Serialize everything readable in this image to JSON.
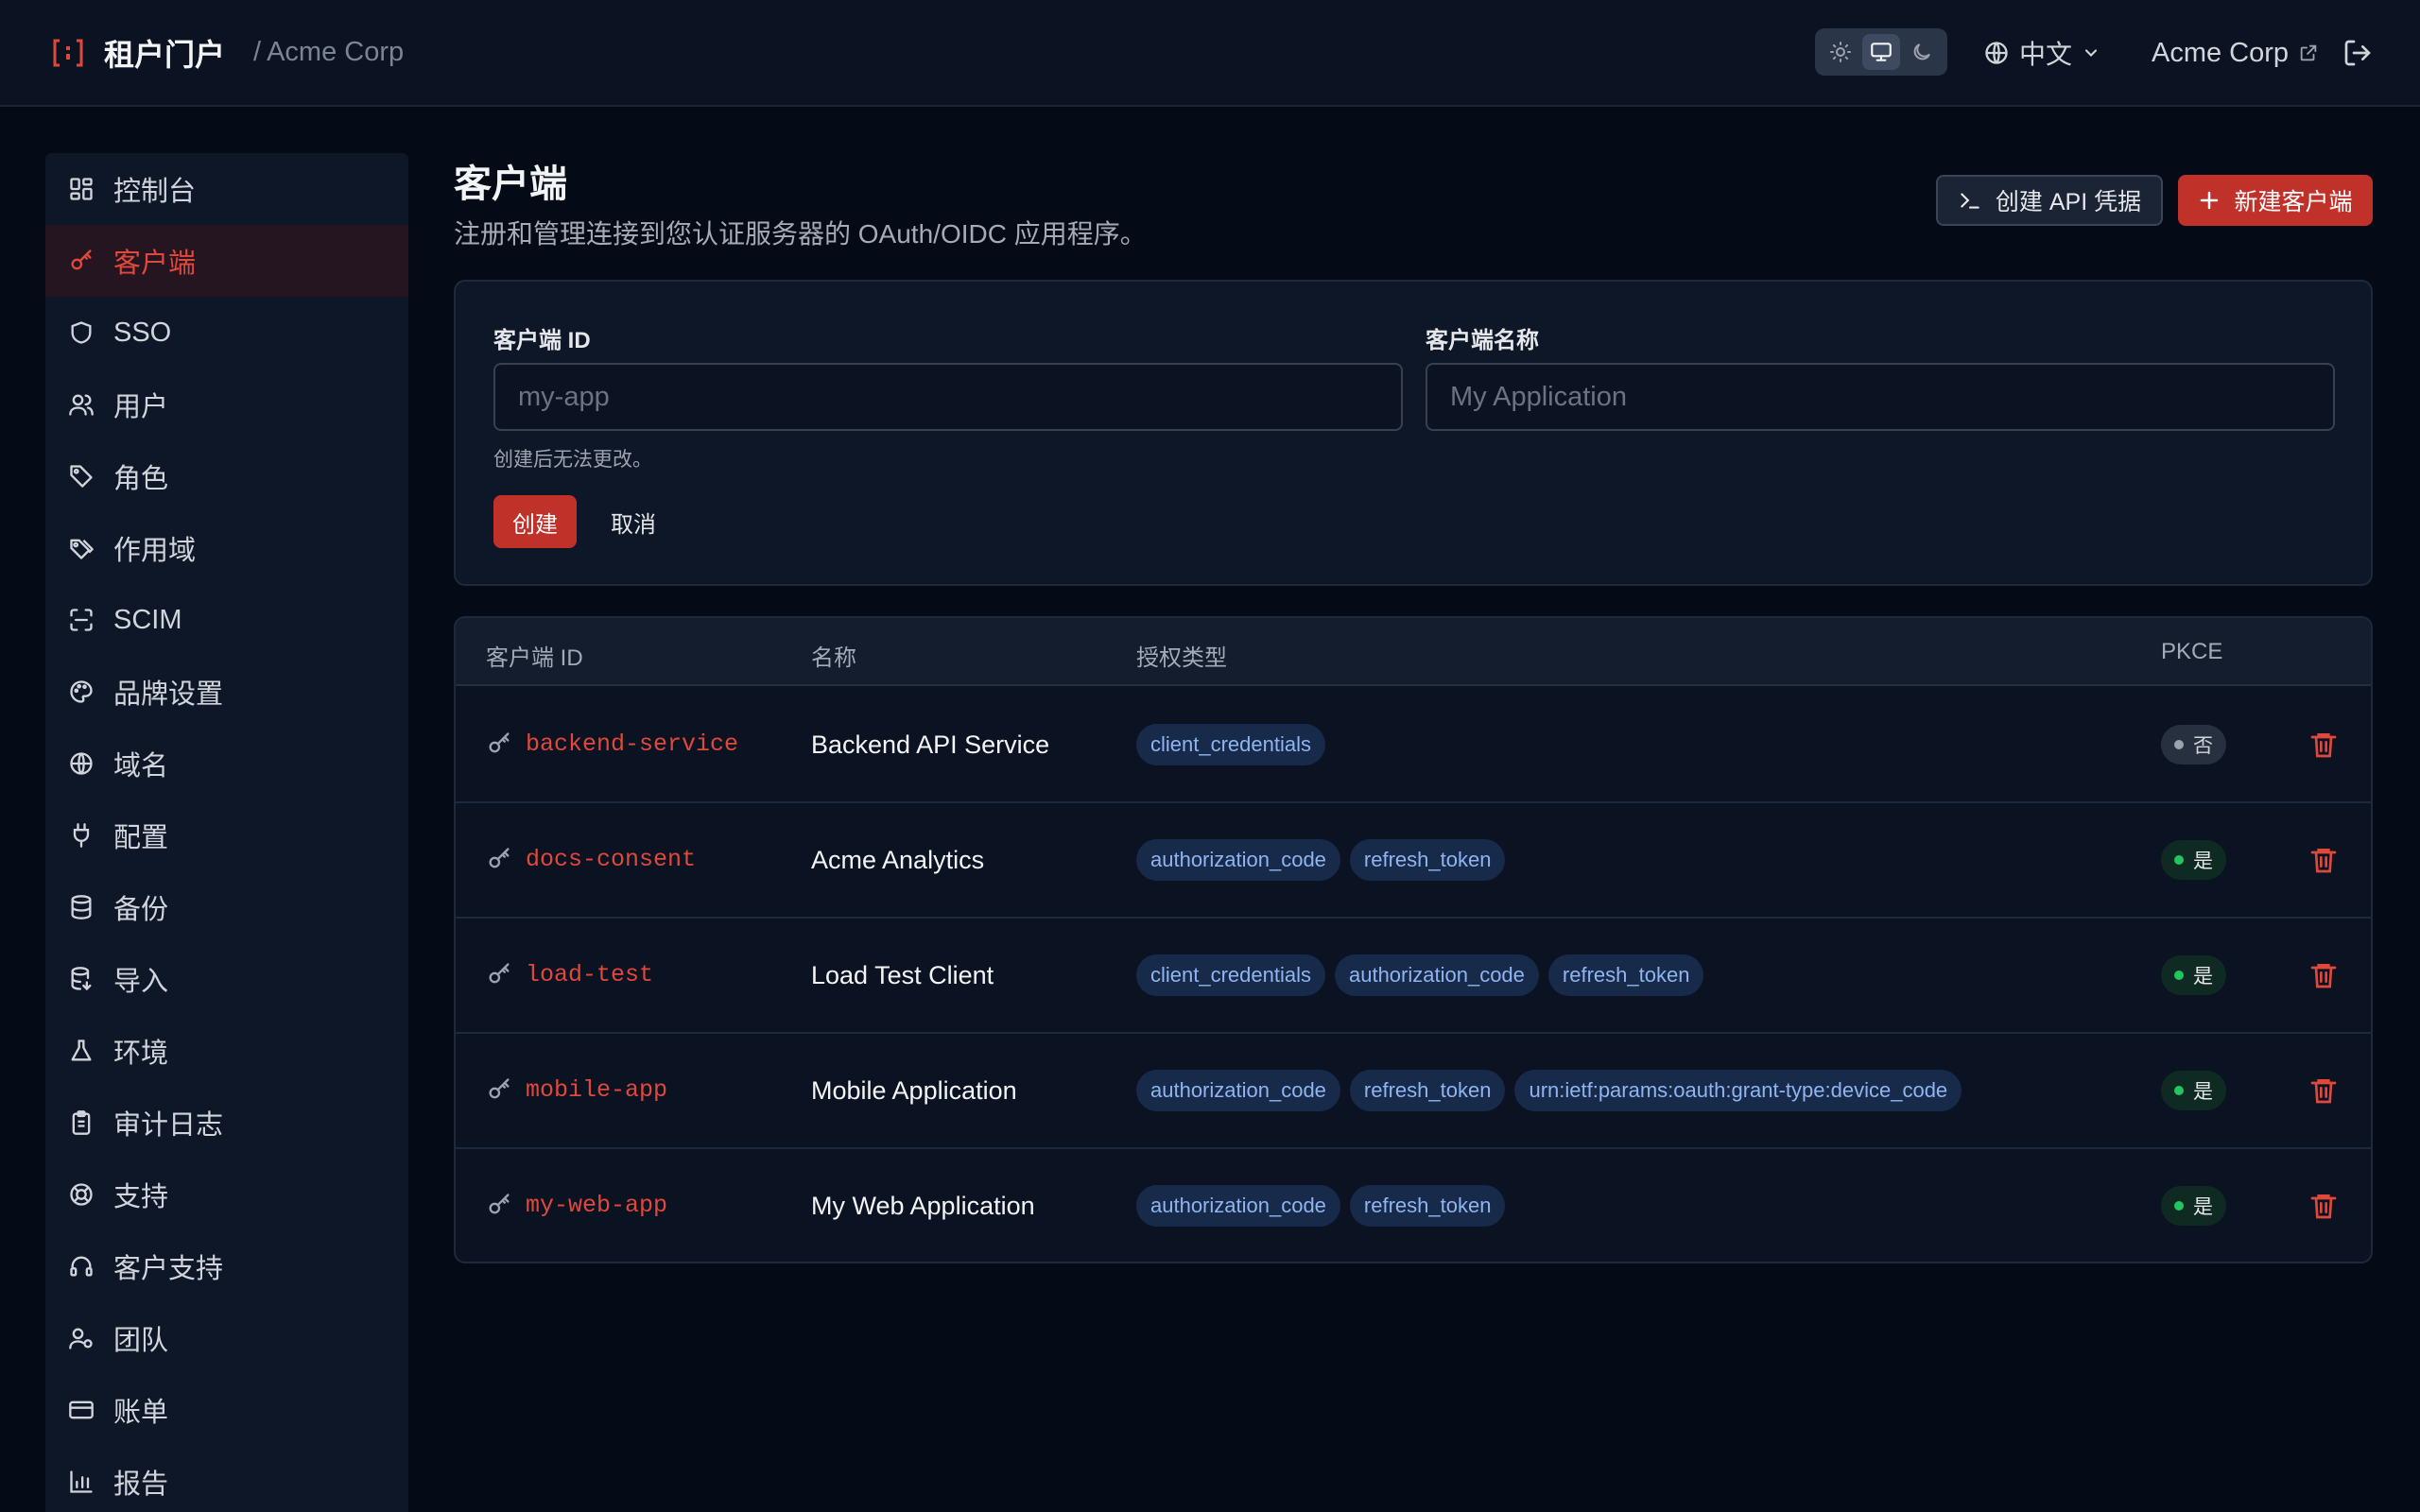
{
  "header": {
    "app_title": "租户门户",
    "separator": "/",
    "org_breadcrumb": "Acme Corp",
    "language": "中文",
    "org_link": "Acme Corp"
  },
  "sidebar": {
    "items": [
      {
        "label": "控制台",
        "icon": "dashboard-icon"
      },
      {
        "label": "客户端",
        "icon": "key-icon",
        "active": true
      },
      {
        "label": "SSO",
        "icon": "shield-icon"
      },
      {
        "label": "用户",
        "icon": "users-icon"
      },
      {
        "label": "角色",
        "icon": "tag-icon"
      },
      {
        "label": "作用域",
        "icon": "tags-icon"
      },
      {
        "label": "SCIM",
        "icon": "scan-icon"
      },
      {
        "label": "品牌设置",
        "icon": "palette-icon"
      },
      {
        "label": "域名",
        "icon": "globe-icon"
      },
      {
        "label": "配置",
        "icon": "plug-icon"
      },
      {
        "label": "备份",
        "icon": "database-icon"
      },
      {
        "label": "导入",
        "icon": "database-import-icon"
      },
      {
        "label": "环境",
        "icon": "flask-icon"
      },
      {
        "label": "审计日志",
        "icon": "clipboard-icon"
      },
      {
        "label": "支持",
        "icon": "lifebuoy-icon"
      },
      {
        "label": "客户支持",
        "icon": "headset-icon"
      },
      {
        "label": "团队",
        "icon": "team-icon"
      },
      {
        "label": "账单",
        "icon": "credit-card-icon"
      },
      {
        "label": "报告",
        "icon": "bar-chart-icon"
      }
    ]
  },
  "page": {
    "title": "客户端",
    "subtitle": "注册和管理连接到您认证服务器的 OAuth/OIDC 应用程序。",
    "create_api_label": "创建 API 凭据",
    "new_client_label": "新建客户端"
  },
  "form": {
    "client_id_label": "客户端 ID",
    "client_id_placeholder": "my-app",
    "client_name_label": "客户端名称",
    "client_name_placeholder": "My Application",
    "hint": "创建后无法更改。",
    "create_label": "创建",
    "cancel_label": "取消"
  },
  "table": {
    "headers": {
      "id": "客户端 ID",
      "name": "名称",
      "grants": "授权类型",
      "pkce": "PKCE"
    },
    "rows": [
      {
        "id": "backend-service",
        "name": "Backend API Service",
        "grants": [
          "client_credentials"
        ],
        "pkce": "否",
        "pkce_enabled": false
      },
      {
        "id": "docs-consent",
        "name": "Acme Analytics",
        "grants": [
          "authorization_code",
          "refresh_token"
        ],
        "pkce": "是",
        "pkce_enabled": true
      },
      {
        "id": "load-test",
        "name": "Load Test Client",
        "grants": [
          "client_credentials",
          "authorization_code",
          "refresh_token"
        ],
        "pkce": "是",
        "pkce_enabled": true
      },
      {
        "id": "mobile-app",
        "name": "Mobile Application",
        "grants": [
          "authorization_code",
          "refresh_token",
          "urn:ietf:params:oauth:grant-type:device_code"
        ],
        "pkce": "是",
        "pkce_enabled": true
      },
      {
        "id": "my-web-app",
        "name": "My Web Application",
        "grants": [
          "authorization_code",
          "refresh_token"
        ],
        "pkce": "是",
        "pkce_enabled": true
      }
    ]
  },
  "colors": {
    "accent": "#c0312a",
    "accent_text": "#e0483c",
    "background": "#050b16",
    "panel": "#0e1728",
    "chip_bg": "#172a4a",
    "chip_text": "#8fb4f0",
    "pkce_yes": "#22c55e"
  }
}
